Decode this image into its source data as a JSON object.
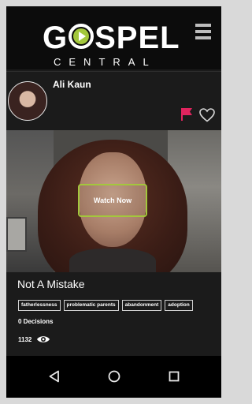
{
  "header": {
    "logo_word_pre": "G",
    "logo_word_post": "SPEL",
    "logo_sub": "CENTRAL",
    "accent_color": "#a3c73c",
    "menu_icon": "hamburger-icon"
  },
  "post": {
    "user_name": "Ali Kaun",
    "flag_color": "#e0245e",
    "video": {
      "watch_label": "Watch Now"
    },
    "title": "Not A Mistake",
    "tags": [
      "fatherlessness",
      "problematic parents",
      "abandonment",
      "adoption"
    ],
    "decisions": "0 Decisions",
    "views": "1132"
  },
  "navbar": {
    "icons": [
      "back-icon",
      "home-icon",
      "recents-icon"
    ]
  }
}
